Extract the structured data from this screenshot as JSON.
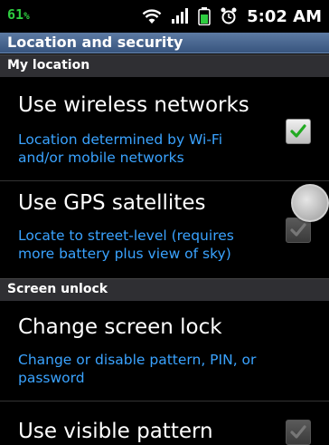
{
  "status_bar": {
    "battery_percent": "61",
    "time": "5:02 AM",
    "icons": [
      "wifi-icon",
      "signal-icon",
      "battery-icon",
      "alarm-icon"
    ]
  },
  "title_bar": {
    "title": "Location and security"
  },
  "sections": {
    "my_location": "My location",
    "screen_unlock": "Screen unlock"
  },
  "items": [
    {
      "title": "Use wireless networks",
      "summary": "Location determined by Wi-Fi and/or mobile networks",
      "checked": true
    },
    {
      "title": "Use GPS satellites",
      "summary": "Locate to street-level (requires more battery plus view of sky)",
      "checked": false
    },
    {
      "title": "Change screen lock",
      "summary": "Change or disable pattern, PIN, or password"
    },
    {
      "title": "Use visible pattern",
      "checked": false
    }
  ],
  "colors": {
    "summary_text": "#3aa3ff",
    "battery_text": "#2ecc40",
    "check_green": "#22aa22",
    "title_bar": "#4a6890"
  }
}
